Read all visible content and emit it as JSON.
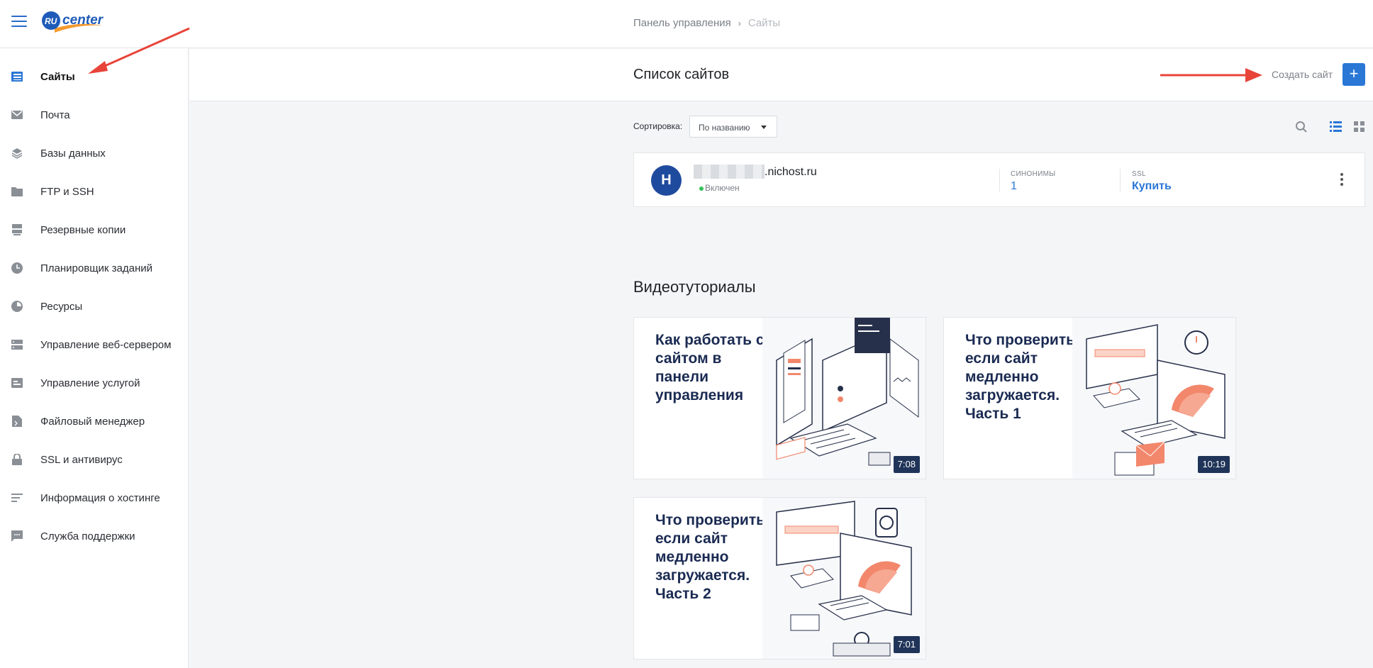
{
  "header": {
    "brand_logo": "ru-center-logo",
    "brand_text_ru": "RU",
    "brand_text_center": "center",
    "breadcrumb": [
      {
        "label": "Панель управления"
      },
      {
        "label": "Сайты"
      }
    ],
    "breadcrumb_separator": "›"
  },
  "sidebar": {
    "items": [
      {
        "label": "Сайты",
        "icon": "sites-icon",
        "active": true
      },
      {
        "label": "Почта",
        "icon": "mail-icon"
      },
      {
        "label": "Базы данных",
        "icon": "database-icon"
      },
      {
        "label": "FTP и SSH",
        "icon": "ftp-icon"
      },
      {
        "label": "Резервные копии",
        "icon": "backup-icon"
      },
      {
        "label": "Планировщик заданий",
        "icon": "scheduler-icon"
      },
      {
        "label": "Ресурсы",
        "icon": "resources-icon"
      },
      {
        "label": "Управление веб-сервером",
        "icon": "webserver-icon"
      },
      {
        "label": "Управление услугой",
        "icon": "service-icon"
      },
      {
        "label": "Файловый менеджер",
        "icon": "file-manager-icon"
      },
      {
        "label": "SSL и антивирус",
        "icon": "lock-icon"
      },
      {
        "label": "Информация о хостинге",
        "icon": "info-icon"
      },
      {
        "label": "Служба поддержки",
        "icon": "support-icon"
      }
    ]
  },
  "main": {
    "title": "Список сайтов",
    "create_label": "Создать сайт",
    "create_button": "+",
    "sort": {
      "label": "Сортировка:",
      "value": "По названию"
    },
    "sites": [
      {
        "avatar_letter": "H",
        "domain_suffix": ".nichost.ru",
        "status": "Включен",
        "synonyms_label": "СИНОНИМЫ",
        "synonyms_value": "1",
        "ssl_label": "SSL",
        "ssl_value": "Купить"
      }
    ],
    "tutorials_title": "Видеотуториалы",
    "tutorials": [
      {
        "title": "Как работать с сайтом в панели управления",
        "duration": "7:08"
      },
      {
        "title": "Что проверить, если сайт медленно загружается. Часть 1",
        "duration": "10:19"
      },
      {
        "title": "Что проверить, если сайт медленно загружается. Часть 2",
        "duration": "7:01"
      }
    ]
  },
  "colors": {
    "accent": "#2a77d6",
    "annotation_arrow": "#e8443a",
    "avatar": "#1f4b9e",
    "status_ok": "#34c259"
  }
}
